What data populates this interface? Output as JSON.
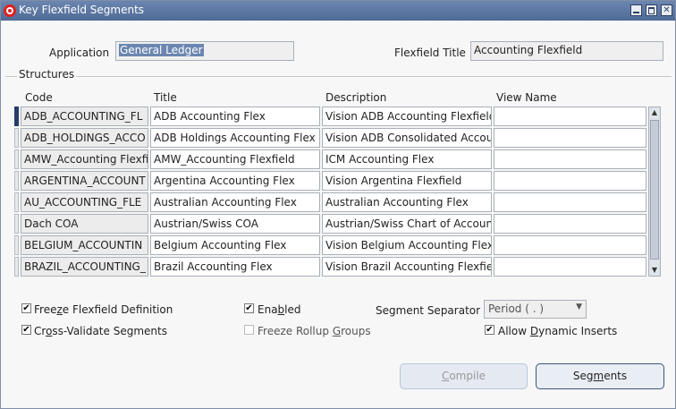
{
  "window": {
    "title": "Key Flexfield Segments"
  },
  "header": {
    "application_label": "Application",
    "application_value": "General Ledger",
    "flexfield_title_label": "Flexfield Title",
    "flexfield_title_value": "Accounting Flexfield"
  },
  "structures": {
    "section_label": "Structures",
    "columns": {
      "code": "Code",
      "title": "Title",
      "description": "Description",
      "view_name": "View Name"
    },
    "rows": [
      {
        "code": "ADB_ACCOUNTING_FL",
        "title": "ADB Accounting Flex",
        "description": "Vision ADB Accounting Flexfield",
        "view_name": ""
      },
      {
        "code": "ADB_HOLDINGS_ACCO",
        "title": "ADB Holdings Accounting Flex",
        "description": "Vision ADB Consolidated Accou",
        "view_name": ""
      },
      {
        "code": "AMW_Accounting Flexfi",
        "title": "AMW_Accounting Flexfield",
        "description": "ICM Accounting Flex",
        "view_name": ""
      },
      {
        "code": "ARGENTINA_ACCOUNT",
        "title": "Argentina Accounting Flex",
        "description": "Vision Argentina Flexfield",
        "view_name": ""
      },
      {
        "code": "AU_ACCOUNTING_FLE",
        "title": "Australian Accounting Flex",
        "description": "Australian Accounting Flex",
        "view_name": ""
      },
      {
        "code": "Dach COA",
        "title": "Austrian/Swiss COA",
        "description": "Austrian/Swiss Chart of Account",
        "view_name": ""
      },
      {
        "code": "BELGIUM_ACCOUNTIN",
        "title": "Belgium Accounting Flex",
        "description": "Vision Belgium Accounting Flex",
        "view_name": ""
      },
      {
        "code": "BRAZIL_ACCOUNTING_",
        "title": "Brazil Accounting Flex",
        "description": "Vision Brazil Accounting Flexfiel",
        "view_name": ""
      }
    ]
  },
  "options": {
    "freeze_flexfield_definition": {
      "pre": "Free",
      "u": "z",
      "post": "e Flexfield Definition",
      "checked": true
    },
    "cross_validate_segments": {
      "pre": "Cr",
      "u": "o",
      "post": "ss-Validate Segments",
      "checked": true
    },
    "enabled": {
      "pre": "Ena",
      "u": "b",
      "post": "led",
      "checked": true
    },
    "freeze_rollup_groups": {
      "pre": "Freeze Rollup ",
      "u": "G",
      "post": "roups",
      "checked": false
    },
    "segment_separator_label": "Segment Separator",
    "segment_separator_value": "Period ( . )",
    "allow_dynamic_inserts": {
      "pre": "Allow ",
      "u": "D",
      "post": "ynamic Inserts",
      "checked": true
    }
  },
  "buttons": {
    "compile": {
      "pre": "",
      "u": "C",
      "post": "ompile"
    },
    "segments": {
      "pre": "Seg",
      "u": "m",
      "post": "ents"
    }
  }
}
